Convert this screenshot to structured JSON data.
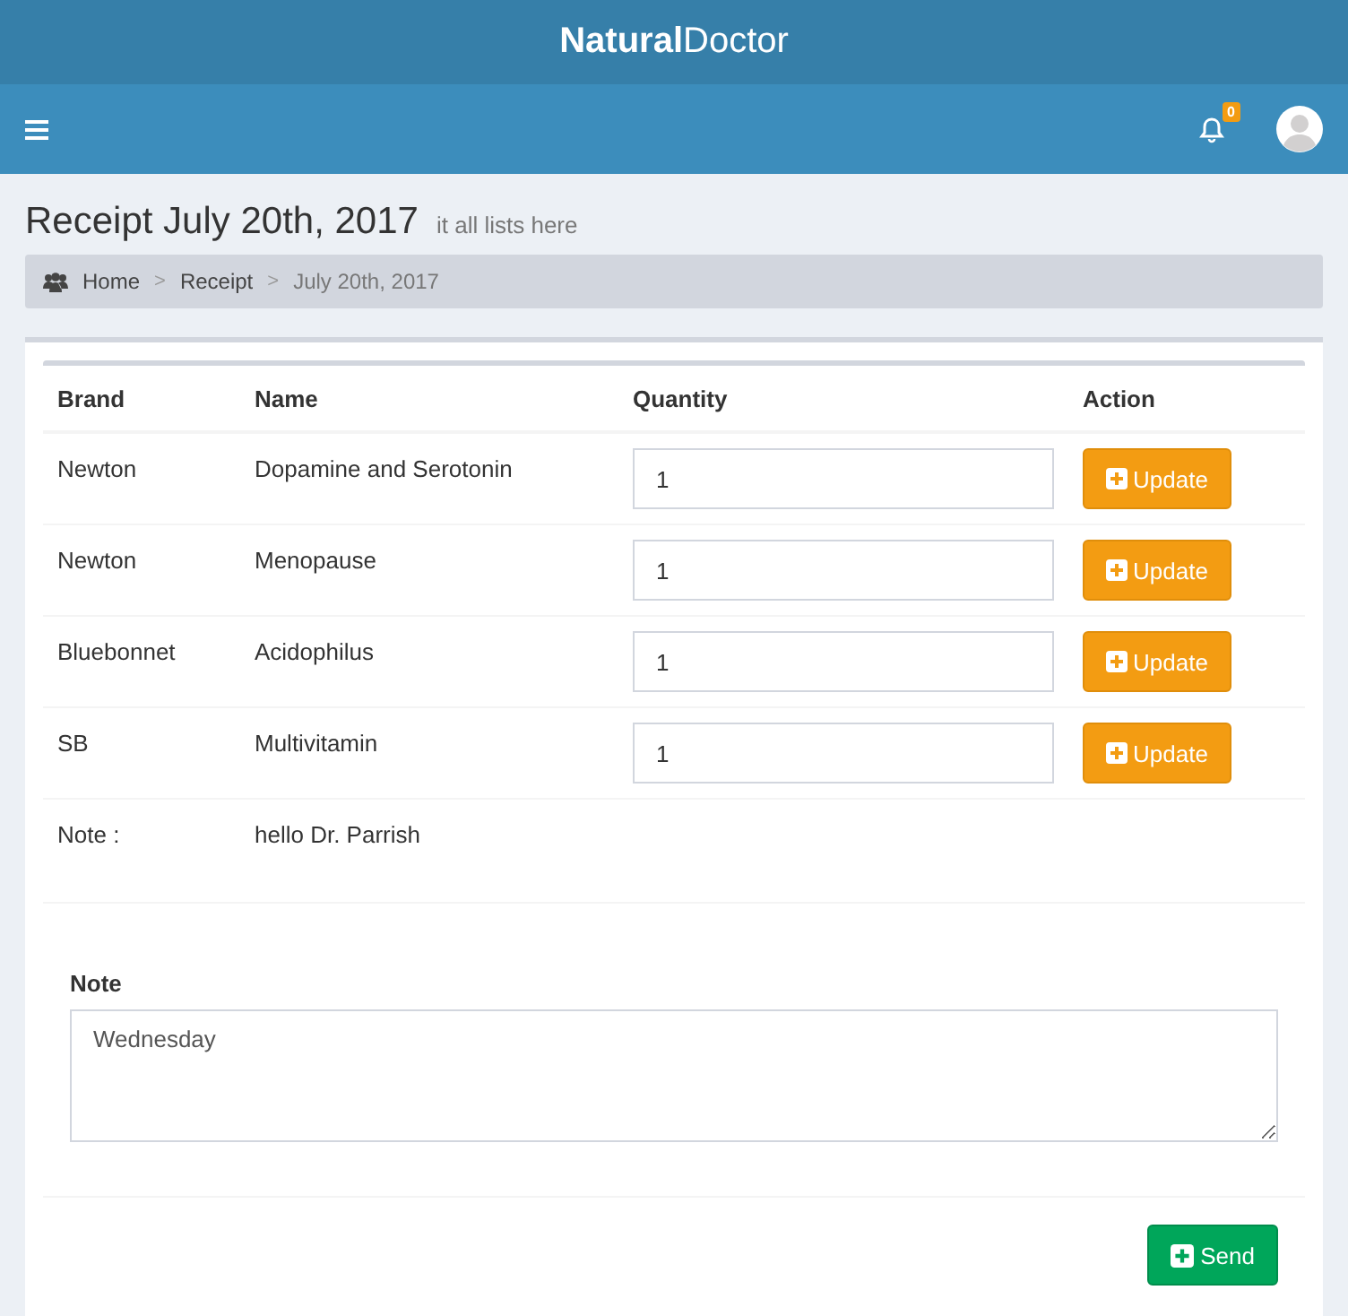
{
  "header": {
    "logo": "**Natural**Doctor"
  },
  "navbar": {
    "notifications_count": "0"
  },
  "page": {
    "title": "Receipt July 20th, 2017",
    "subtitle": "it all lists here"
  },
  "breadcrumb": [
    {
      "label": "Home",
      "current": false
    },
    {
      "label": "Receipt",
      "current": false
    },
    {
      "label": "July 20th, 2017",
      "current": true
    }
  ],
  "breadcrumb_separator": ">",
  "table": {
    "columns": [
      "Brand",
      "Name",
      "Quantity",
      "Action"
    ],
    "rows": [
      {
        "brand": "Newton",
        "name": "Dopamine and Serotonin",
        "quantity": "1",
        "action": "Update"
      },
      {
        "brand": "Newton",
        "name": "Menopause",
        "quantity": "1",
        "action": "Update"
      },
      {
        "brand": "Bluebonnet",
        "name": "Acidophilus",
        "quantity": "1",
        "action": "Update"
      },
      {
        "brand": "SB",
        "name": "Multivitamin",
        "quantity": "1",
        "action": "Update"
      }
    ],
    "note_row": {
      "label": "Note :",
      "value": "hello Dr. Parrish"
    }
  },
  "note_field": {
    "label": "Note",
    "value": "Wednesday"
  },
  "send_button": "Send"
}
